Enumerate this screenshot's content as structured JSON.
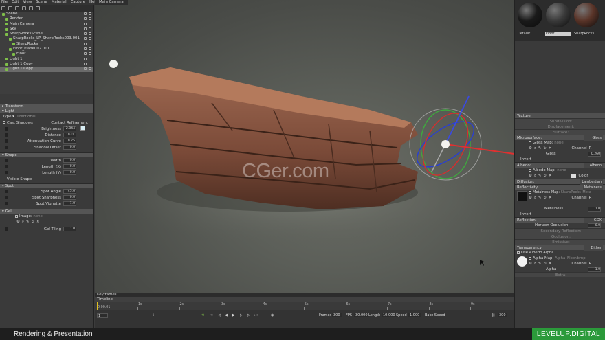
{
  "menu": [
    "File",
    "Edit",
    "View",
    "Scene",
    "Material",
    "Capture",
    "Help"
  ],
  "scene_tree": [
    {
      "label": "Scene",
      "indent": 0,
      "selected": false
    },
    {
      "label": "Render",
      "indent": 1,
      "selected": false
    },
    {
      "label": "Main Camera",
      "indent": 1,
      "selected": false
    },
    {
      "label": "Sky",
      "indent": 1,
      "selected": false
    },
    {
      "label": "SharpRocksScene",
      "indent": 1,
      "selected": false
    },
    {
      "label": "SharpRocks_LP_SharpRocks003.001",
      "indent": 2,
      "selected": false
    },
    {
      "label": "SharpRocks",
      "indent": 3,
      "selected": false
    },
    {
      "label": "Floor_Plane002.001",
      "indent": 2,
      "selected": false
    },
    {
      "label": "Floor",
      "indent": 3,
      "selected": false
    },
    {
      "label": "Light 1",
      "indent": 1,
      "selected": false
    },
    {
      "label": "Light 1 Copy",
      "indent": 1,
      "selected": false
    },
    {
      "label": "Light 1 Copy",
      "indent": 1,
      "selected": true
    }
  ],
  "transform": {
    "header": "Transform"
  },
  "light": {
    "header": "Light",
    "type_label": "Type ▾",
    "type_value": "Directional",
    "cast_shadows": "Cast Shadows",
    "contact_refinement": "Contact Refinement",
    "props": [
      {
        "label": "Brightness",
        "value": "2.844"
      },
      {
        "label": "Distance",
        "value": "1031."
      },
      {
        "label": "Attenuation Curve",
        "value": "0.75"
      },
      {
        "label": "Shadow Offset",
        "value": "0.0"
      }
    ]
  },
  "shape": {
    "header": "Shape",
    "props": [
      {
        "label": "Width",
        "value": "0.0"
      },
      {
        "label": "Length (X)",
        "value": "0.0"
      },
      {
        "label": "Length (Y)",
        "value": "0.0"
      }
    ],
    "visible_shape": "Visible Shape"
  },
  "spot": {
    "header": "Spot",
    "props": [
      {
        "label": "Spot Angle",
        "value": "45.0"
      },
      {
        "label": "Spot Sharpness",
        "value": "0.0"
      },
      {
        "label": "Spot Vignette",
        "value": "1.0"
      }
    ]
  },
  "gel": {
    "header": "Gel",
    "image_label": "Image:",
    "image_value": "none",
    "tiling_label": "Gel Tiling",
    "tiling_value": "1.0"
  },
  "viewport": {
    "tab": "Main Camera",
    "watermark": "CGer.com"
  },
  "timeline": {
    "keyframes": "Keyframes",
    "tab": "Timeline",
    "ticks": [
      "1s",
      "2s",
      "3s",
      "4s",
      "5s",
      "6s",
      "7s",
      "8s",
      "9s"
    ],
    "current_time": "0:00.01",
    "frame_value": "1",
    "frames_label": "Frames",
    "frames_value": "300",
    "fps_label": "FPS",
    "fps_value": "30.000",
    "length_label": "Length",
    "length_value": "10.000",
    "speed_label": "Speed",
    "speed_value": "1.000",
    "bake_label": "Bake Speed",
    "end_value": "300"
  },
  "materials": [
    {
      "name": "Default",
      "selected": false,
      "color": "#1a1a1a"
    },
    {
      "name": "Floor",
      "selected": true,
      "color": "#3a3a3a"
    },
    {
      "name": "SharpRocks",
      "selected": false,
      "color": "#5a3428"
    }
  ],
  "right_panel": {
    "texture": "Texture",
    "subdivision": "Subdivision:",
    "displacement": "Displacement:",
    "surface": "Surface:",
    "microsurface": "Microsurface:",
    "microsurface_mode": "Gloss",
    "gloss_map_label": "Gloss Map:",
    "gloss_map_value": "none",
    "channel": "Channel",
    "channel_value": "R",
    "gloss_label": "Gloss",
    "gloss_value": "0.260",
    "invert": "Invert",
    "albedo": "Albedo:",
    "albedo_mode": "Albedo",
    "albedo_map_label": "Albedo Map:",
    "albedo_map_value": "none",
    "color_label": "Color",
    "diffusion": "Diffusion:",
    "diffusion_mode": "Lambertian",
    "reflectivity": "Reflectivity:",
    "reflectivity_mode": "Metalness",
    "metal_map_label": "Metalness Map:",
    "metal_map_value": "SharpRocks_Metallic.Jpg",
    "metalness_label": "Metalness",
    "metalness_value": "1.0",
    "reflection": "Reflection:",
    "reflection_mode": "GGX",
    "horizon_label": "Horizon Occlusion",
    "horizon_value": "0.0",
    "secondary_reflection": "Secondary Reflection:",
    "occlusion": "Occlusion:",
    "emissive": "Emissive:",
    "transparency": "Transparency:",
    "transparency_mode": "Dither",
    "use_albedo_alpha": "Use Albedo Alpha",
    "alpha_map_label": "Alpha Map:",
    "alpha_map_value": "Alpha_Floor.bmp",
    "alpha_label": "Alpha",
    "alpha_value": "1.0",
    "extra": "Extra:"
  },
  "status": {
    "title": "Rendering & Presentation",
    "brand": "LEVELUP.DIGITAL"
  }
}
